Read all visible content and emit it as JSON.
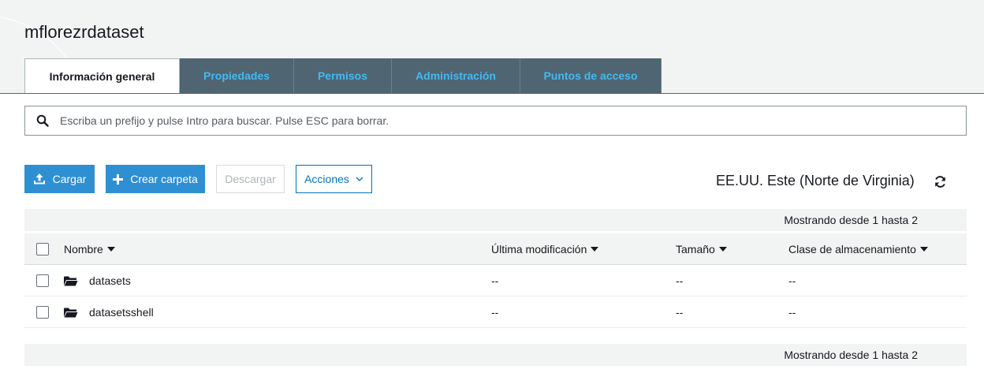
{
  "bucket": {
    "name": "mflorezrdataset"
  },
  "tabs": [
    {
      "label": "Información general",
      "active": true
    },
    {
      "label": "Propiedades"
    },
    {
      "label": "Permisos"
    },
    {
      "label": "Administración"
    },
    {
      "label": "Puntos de acceso"
    }
  ],
  "search": {
    "placeholder": "Escriba un prefijo y pulse Intro para buscar. Pulse ESC para borrar.",
    "icon": "search-icon"
  },
  "toolbar": {
    "upload_label": "Cargar",
    "create_folder_label": "Crear carpeta",
    "download_label": "Descargar",
    "actions_label": "Acciones",
    "region": "EE.UU. Este (Norte de Virginia)"
  },
  "pagination": {
    "top_text": "Mostrando desde 1 hasta 2",
    "bottom_text": "Mostrando desde 1 hasta 2"
  },
  "table": {
    "columns": [
      "Nombre",
      "Última modificación",
      "Tamaño",
      "Clase de almacenamiento"
    ],
    "rows": [
      {
        "name": "datasets",
        "modified": "--",
        "size": "--",
        "storage_class": "--"
      },
      {
        "name": "datasetsshell",
        "modified": "--",
        "size": "--",
        "storage_class": "--"
      }
    ]
  },
  "colors": {
    "primary": "#2e8fd3",
    "tab_bg": "#4f6572",
    "tab_text": "#44b9f0",
    "link": "#0073bb"
  }
}
